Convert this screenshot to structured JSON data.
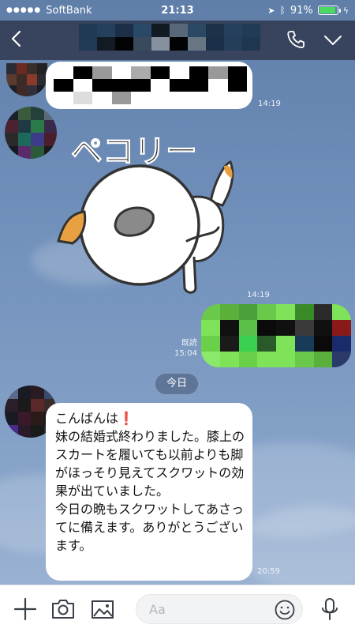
{
  "status_bar": {
    "carrier": "SoftBank",
    "time": "21:13",
    "battery": "91%",
    "battery_level": 0.91
  },
  "header": {
    "back_icon": "back-chevron-icon",
    "call_icon": "phone-icon",
    "menu_icon": "chevron-down-icon"
  },
  "messages": {
    "first_time": "14:19",
    "sticker_text": "ペコリー",
    "sticker_time": "14:19",
    "read_label": "既読",
    "sent_time": "15:04",
    "date_divider": "今日",
    "last_text": "こんばんは❗\n妹の結婚式終わりました。膝上のスカートを履いても以前よりも脚がほっそり見えてスクワットの効果が出ていました。\n今日の晩もスクワットしてあさってに備えます。ありがとうございます。",
    "last_time": "20:59"
  },
  "input": {
    "placeholder": "Aa"
  },
  "colors": {
    "header_bg": "#343e56",
    "battery_green": "#4cd964",
    "bubble_green": "#7fe35a"
  }
}
